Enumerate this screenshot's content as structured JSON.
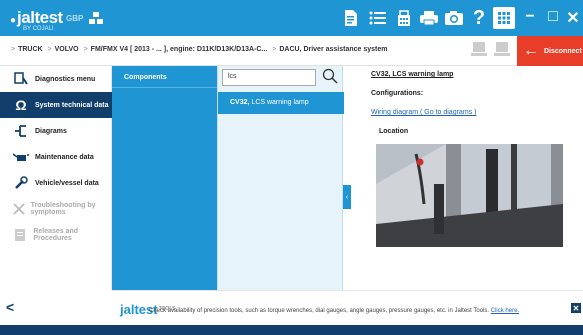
{
  "header": {
    "brand": "jaltest",
    "brand_sub": "BY COJALI",
    "currency": "GBP",
    "disconnect_label": "Disconnect",
    "minimize_label": "−",
    "maximize_label": "□",
    "close_label": "✕"
  },
  "breadcrumb": {
    "items": [
      "TRUCK",
      "VOLVO",
      "FM/FMX V4 [ 2013 - ... ], engine: D11K/D13K/D13A-C...",
      "DACU, Driver assistance system"
    ]
  },
  "sidebar": {
    "items": [
      {
        "label": "Diagnostics menu"
      },
      {
        "label": "System technical data"
      },
      {
        "label": "Diagrams"
      },
      {
        "label": "Maintenance data"
      },
      {
        "label": "Vehicle/vessel data"
      },
      {
        "label": "Troubleshooting by symptoms"
      },
      {
        "label": "Releases and Procedures"
      }
    ],
    "back_label": "<"
  },
  "components": {
    "header": "Components"
  },
  "search": {
    "value": "lcs"
  },
  "results": {
    "items": [
      {
        "code": "CV32,",
        "label": "LCS warning lamp"
      }
    ]
  },
  "detail": {
    "title": "CV32, LCS warning lamp",
    "configurations_label": "Configurations:",
    "wiring_link": "Wiring diagram ( Go to diagrams )",
    "location_label": "Location"
  },
  "infobar": {
    "logo_main": "jaltest",
    "logo_sub": "TOOLS",
    "text": "Check availability of precision tools, such as torque wrenches, dial gauges, angle gauges, pressure gauges, etc. in Jaltest Tools.",
    "link": "Click here.",
    "close": "✕"
  },
  "colors": {
    "primary": "#1f95d4",
    "navy": "#123e6b",
    "disconnect": "#e83e29",
    "list_bg": "#e6f3fb"
  }
}
